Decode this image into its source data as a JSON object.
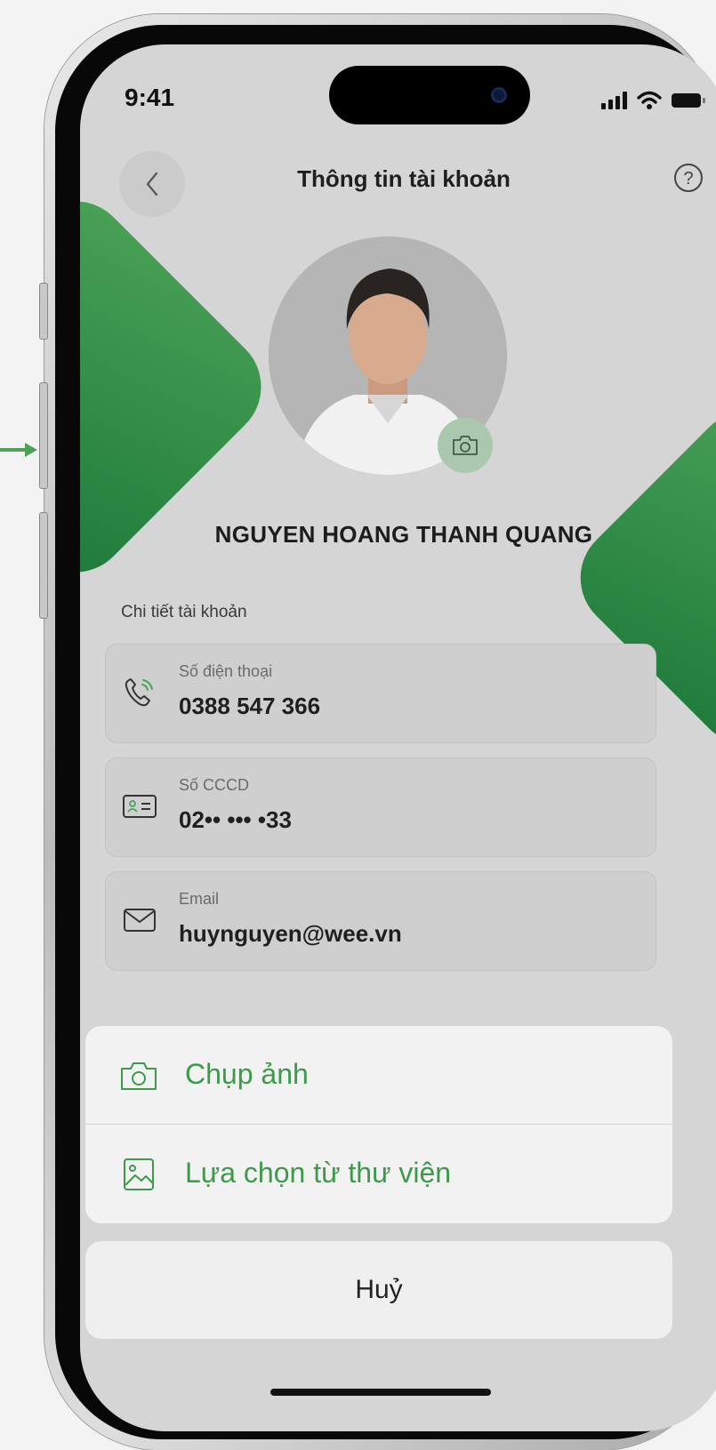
{
  "status_bar": {
    "time": "9:41"
  },
  "header": {
    "title": "Thông tin tài khoản"
  },
  "profile": {
    "name": "NGUYEN HOANG THANH QUANG"
  },
  "details": {
    "section_label": "Chi tiết tài khoản",
    "items": [
      {
        "icon": "phone-icon",
        "label": "Số điện thoại",
        "value": "0388 547 366"
      },
      {
        "icon": "id-card-icon",
        "label": "Số CCCD",
        "value": "02•• ••• •33"
      },
      {
        "icon": "mail-icon",
        "label": "Email",
        "value": "huynguyen@wee.vn"
      }
    ]
  },
  "action_sheet": {
    "options": [
      {
        "icon": "camera-icon",
        "label": "Chụp ảnh"
      },
      {
        "icon": "gallery-icon",
        "label": "Lựa chọn từ thư viện"
      }
    ],
    "cancel_label": "Huỷ"
  },
  "colors": {
    "accent": "#3d9a4a",
    "deco_green": "#2e8b45",
    "screen_bg": "#d5d5d5"
  }
}
